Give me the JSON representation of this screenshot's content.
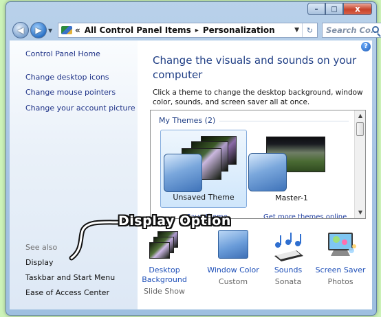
{
  "window": {
    "caption_buttons": {
      "minimize": "–",
      "maximize": "□",
      "close": "x"
    }
  },
  "navbar": {
    "address_prefix": "«",
    "path": [
      "All Control Panel Items",
      "Personalization"
    ],
    "separator": "▸",
    "search_placeholder": "Search Co..."
  },
  "sidebar": {
    "links": [
      "Control Panel Home",
      "Change desktop icons",
      "Change mouse pointers",
      "Change your account picture"
    ],
    "see_also_label": "See also",
    "see_also_links": [
      "Display",
      "Taskbar and Start Menu",
      "Ease of Access Center"
    ]
  },
  "main": {
    "title": "Change the visuals and sounds on your computer",
    "description": "Click a theme to change the desktop background, window color, sounds, and screen saver all at once.",
    "group_label": "My Themes (2)",
    "themes": [
      {
        "name": "Unsaved Theme",
        "selected": true
      },
      {
        "name": "Master-1",
        "selected": false
      }
    ],
    "links_partial": [
      "Save theme",
      "Get more themes online"
    ],
    "bottom_items": [
      {
        "label": "Desktop Background",
        "sub": "Slide Show",
        "icon": "photos-stack-icon"
      },
      {
        "label": "Window Color",
        "sub": "Custom",
        "icon": "window-color-icon"
      },
      {
        "label": "Sounds",
        "sub": "Sonata",
        "icon": "music-notes-icon"
      },
      {
        "label": "Screen Saver",
        "sub": "Photos",
        "icon": "screen-saver-icon"
      }
    ]
  },
  "annotation": {
    "text": "Display Option"
  },
  "colors": {
    "page_bg": "#ccf3b8",
    "link": "#1e3287",
    "title": "#1e3d84"
  }
}
